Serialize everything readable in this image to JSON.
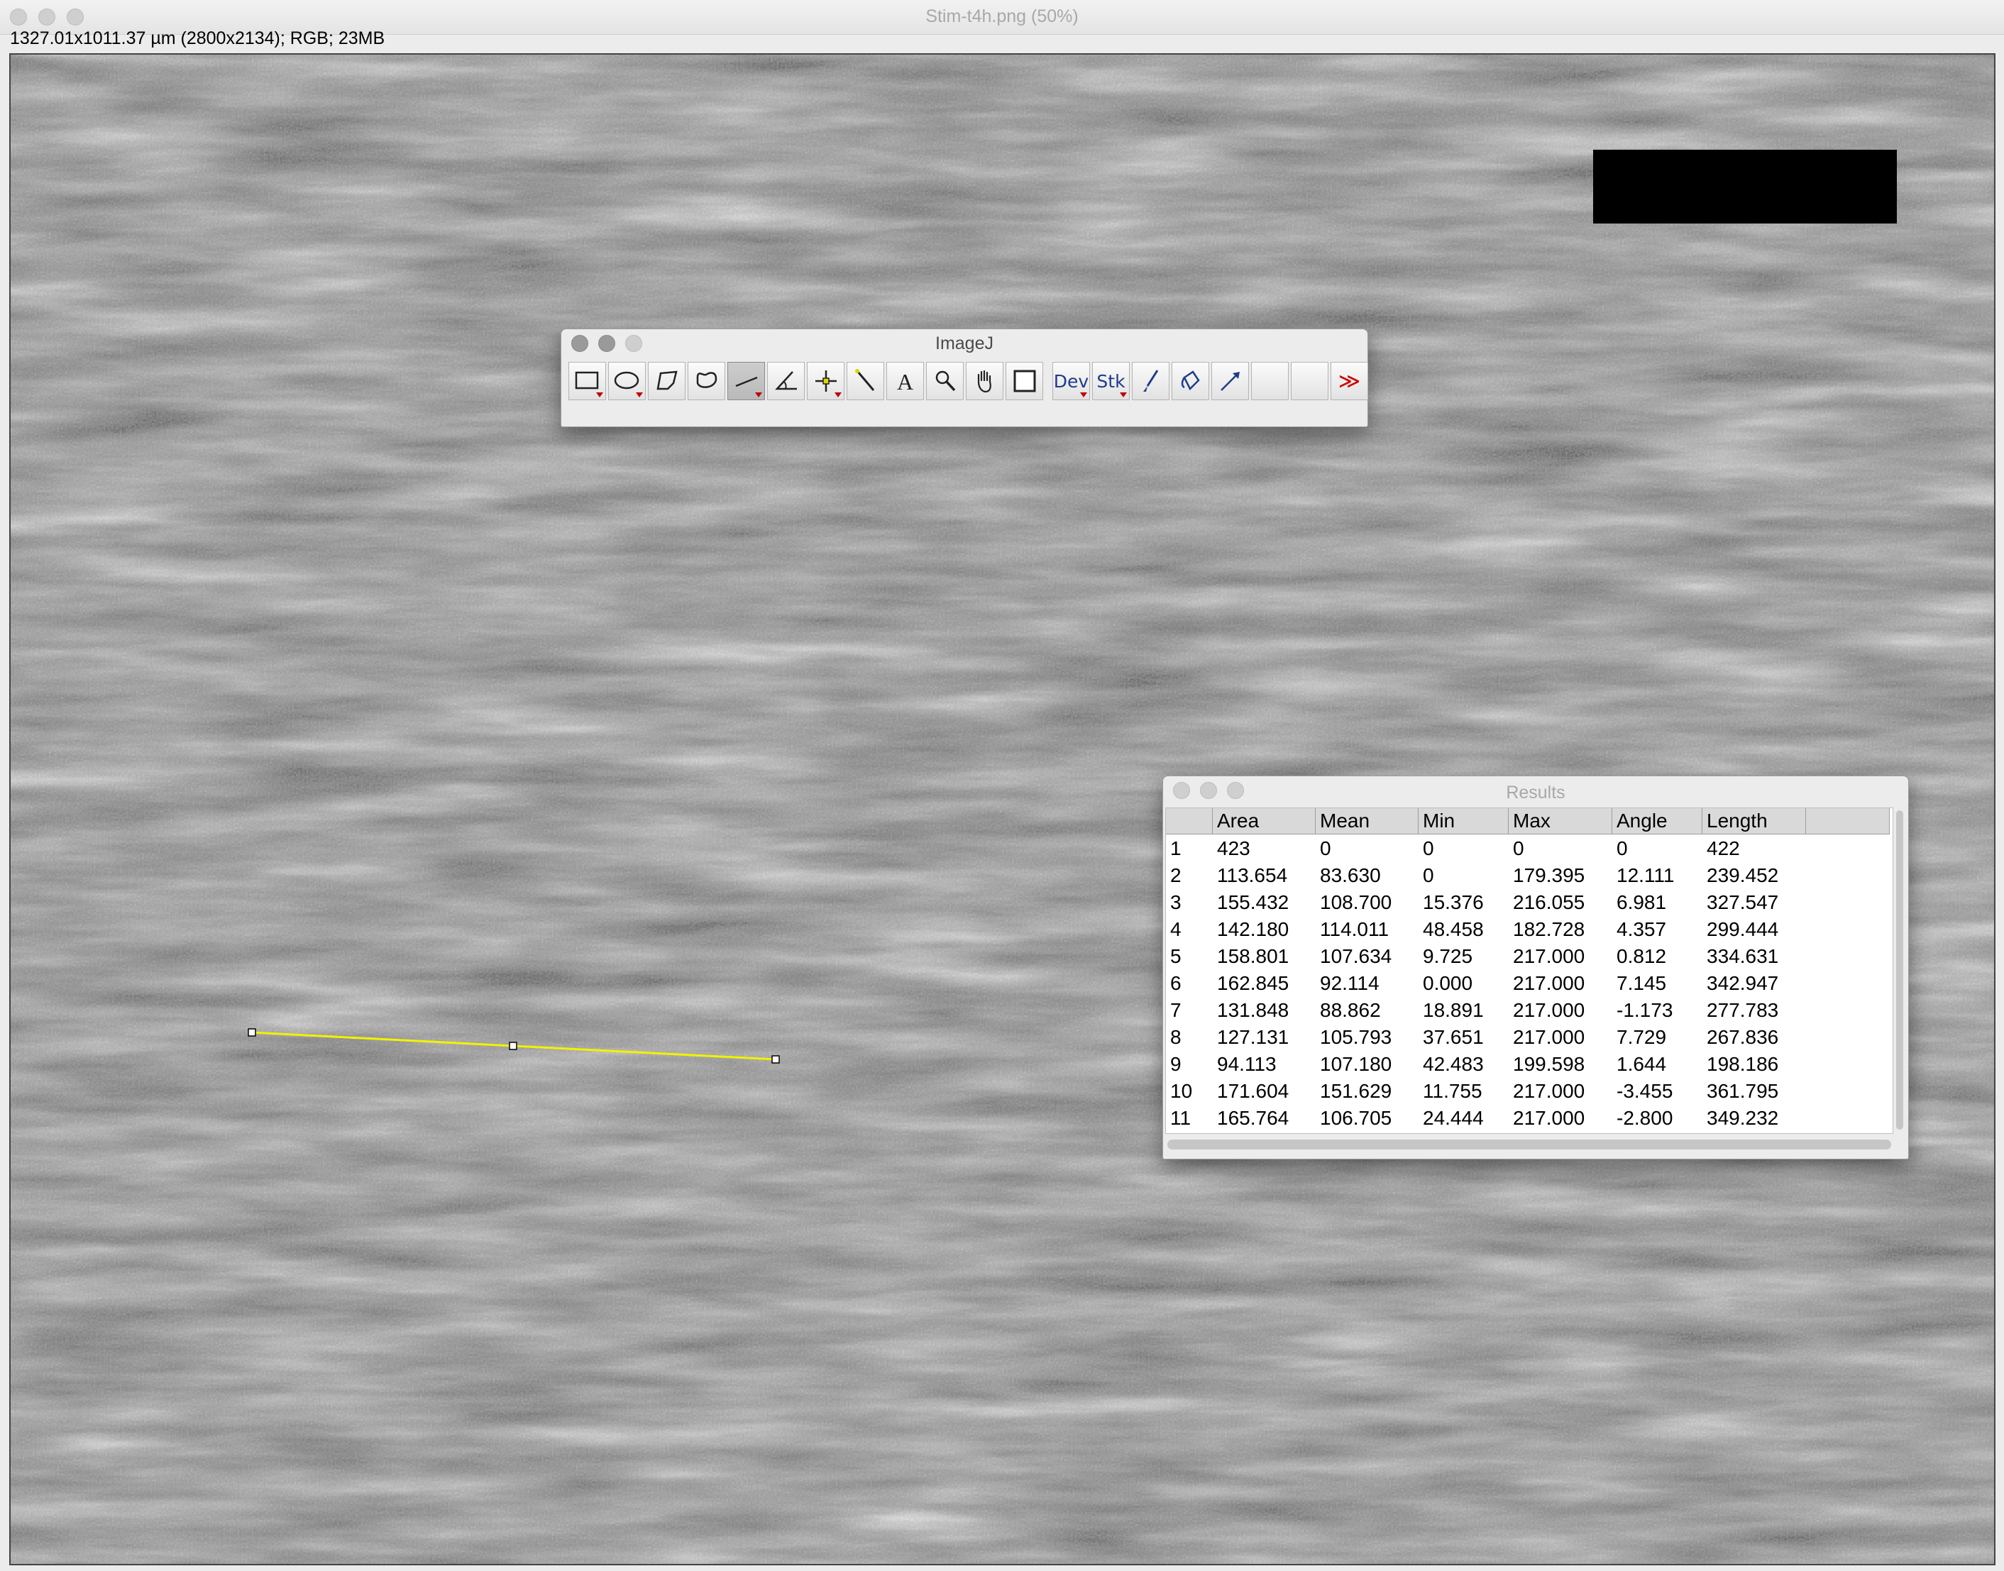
{
  "image_window": {
    "title": "Stim-t4h.png (50%)",
    "info": "1327.01x1011.37 µm (2800x2134); RGB; 23MB"
  },
  "toolbar": {
    "title": "ImageJ",
    "tools": [
      {
        "name": "rectangle-tool",
        "icon": "rectangle-icon",
        "has_menu": true
      },
      {
        "name": "oval-tool",
        "icon": "oval-icon",
        "has_menu": true
      },
      {
        "name": "polygon-tool",
        "icon": "polygon-icon",
        "has_menu": false
      },
      {
        "name": "freehand-tool",
        "icon": "freehand-icon",
        "has_menu": false
      },
      {
        "name": "line-tool",
        "icon": "straight-line-icon",
        "has_menu": true,
        "selected": true
      },
      {
        "name": "angle-tool",
        "icon": "angle-icon",
        "has_menu": false
      },
      {
        "name": "point-tool",
        "icon": "point-icon",
        "has_menu": true
      },
      {
        "name": "wand-tool",
        "icon": "wand-icon",
        "has_menu": false
      },
      {
        "name": "text-tool",
        "icon": "text-icon",
        "label": "A",
        "has_menu": false
      },
      {
        "name": "magnifier-tool",
        "icon": "magnifier-icon",
        "has_menu": false
      },
      {
        "name": "scroll-tool",
        "icon": "hand-icon",
        "has_menu": false
      },
      {
        "name": "color-picker-tool",
        "icon": "color-square-icon",
        "has_menu": false
      },
      {
        "name": "dev-menu-tool",
        "icon": "dev-icon",
        "label": "Dev",
        "has_menu": true
      },
      {
        "name": "stack-menu-tool",
        "icon": "stack-icon",
        "label": "Stk",
        "has_menu": true
      },
      {
        "name": "brush-tool",
        "icon": "brush-icon",
        "has_menu": false
      },
      {
        "name": "flood-fill-tool",
        "icon": "flood-fill-icon",
        "has_menu": false
      },
      {
        "name": "pencil-tool",
        "icon": "arrow-pencil-icon",
        "has_menu": false
      },
      {
        "name": "empty-slot-1",
        "icon": "",
        "has_menu": false
      },
      {
        "name": "empty-slot-2",
        "icon": "",
        "has_menu": false
      },
      {
        "name": "more-tools",
        "icon": "double-chevron-right-icon",
        "label": "≫",
        "has_menu": false
      }
    ]
  },
  "results": {
    "title": "Results",
    "columns": [
      "",
      "Area",
      "Mean",
      "Min",
      "Max",
      "Angle",
      "Length",
      ""
    ],
    "rows": [
      [
        "1",
        "423",
        "0",
        "0",
        "0",
        "0",
        "422"
      ],
      [
        "2",
        "113.654",
        "83.630",
        "0",
        "179.395",
        "12.111",
        "239.452"
      ],
      [
        "3",
        "155.432",
        "108.700",
        "15.376",
        "216.055",
        "6.981",
        "327.547"
      ],
      [
        "4",
        "142.180",
        "114.011",
        "48.458",
        "182.728",
        "4.357",
        "299.444"
      ],
      [
        "5",
        "158.801",
        "107.634",
        "9.725",
        "217.000",
        "0.812",
        "334.631"
      ],
      [
        "6",
        "162.845",
        "92.114",
        "0.000",
        "217.000",
        "7.145",
        "342.947"
      ],
      [
        "7",
        "131.848",
        "88.862",
        "18.891",
        "217.000",
        "-1.173",
        "277.783"
      ],
      [
        "8",
        "127.131",
        "105.793",
        "37.651",
        "217.000",
        "7.729",
        "267.836"
      ],
      [
        "9",
        "94.113",
        "107.180",
        "42.483",
        "199.598",
        "1.644",
        "198.186"
      ],
      [
        "10",
        "171.604",
        "151.629",
        "11.755",
        "217.000",
        "-3.455",
        "361.795"
      ],
      [
        "11",
        "165.764",
        "106.705",
        "24.444",
        "217.000",
        "-2.800",
        "349.232"
      ]
    ]
  },
  "colors": {
    "selection_line": "#f2f200",
    "toolbar_label": "#1e3c8c",
    "more_tools": "#d00000"
  }
}
